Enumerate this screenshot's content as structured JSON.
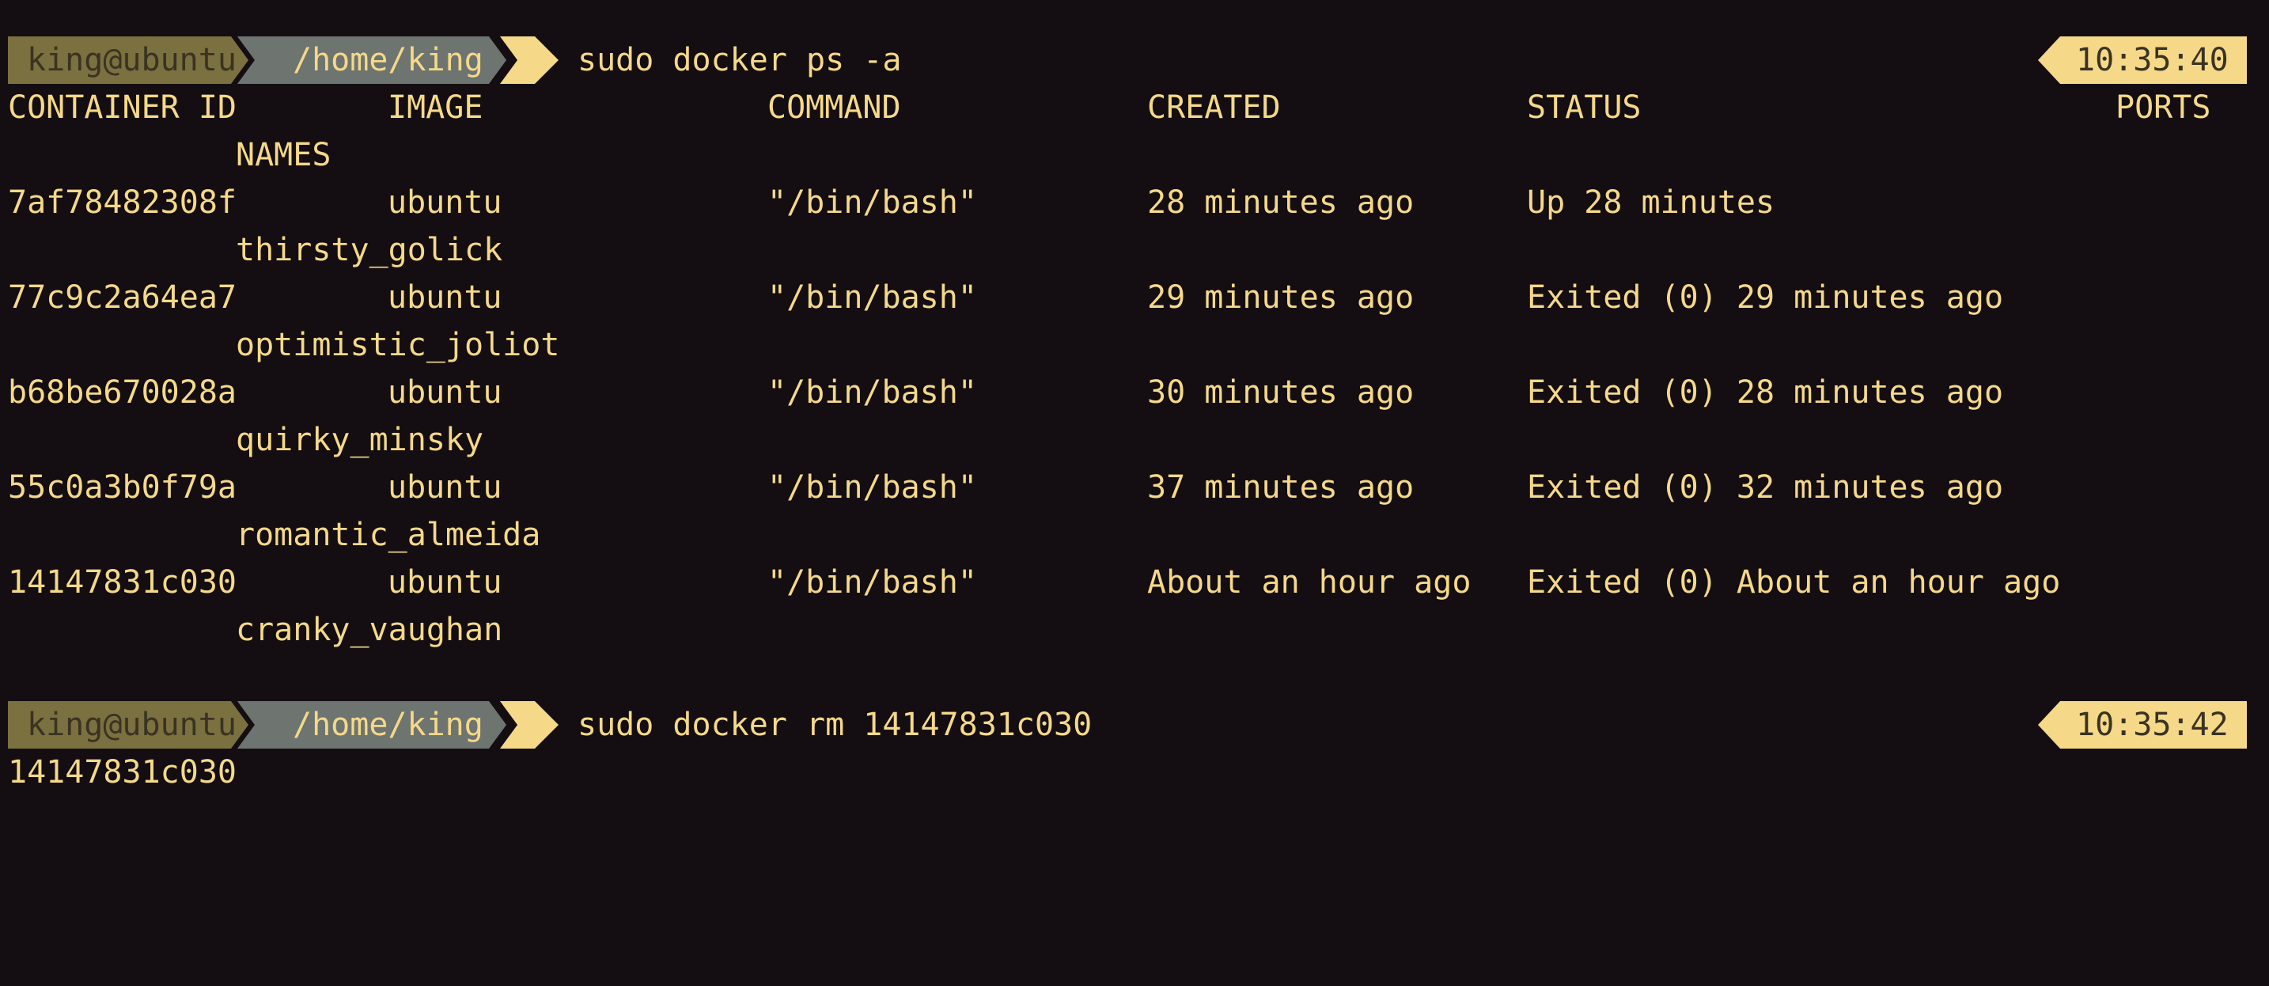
{
  "prompt1": {
    "user": "king@ubuntu",
    "path": "/home/king",
    "command": "sudo docker ps -a",
    "time": "10:35:40"
  },
  "headers": {
    "container_id": "CONTAINER ID",
    "image": "IMAGE",
    "command": "COMMAND",
    "created": "CREATED",
    "status": "STATUS",
    "ports": "PORTS",
    "names": "NAMES"
  },
  "rows": [
    {
      "container_id": "7af78482308f",
      "image": "ubuntu",
      "command": "\"/bin/bash\"",
      "created": "28 minutes ago",
      "status": "Up 28 minutes",
      "names": "thirsty_golick"
    },
    {
      "container_id": "77c9c2a64ea7",
      "image": "ubuntu",
      "command": "\"/bin/bash\"",
      "created": "29 minutes ago",
      "status": "Exited (0) 29 minutes ago",
      "names": "optimistic_joliot"
    },
    {
      "container_id": "b68be670028a",
      "image": "ubuntu",
      "command": "\"/bin/bash\"",
      "created": "30 minutes ago",
      "status": "Exited (0) 28 minutes ago",
      "names": "quirky_minsky"
    },
    {
      "container_id": "55c0a3b0f79a",
      "image": "ubuntu",
      "command": "\"/bin/bash\"",
      "created": "37 minutes ago",
      "status": "Exited (0) 32 minutes ago",
      "names": "romantic_almeida"
    },
    {
      "container_id": "14147831c030",
      "image": "ubuntu",
      "command": "\"/bin/bash\"",
      "created": "About an hour ago",
      "status": "Exited (0) About an hour ago",
      "names": "cranky_vaughan"
    }
  ],
  "prompt2": {
    "user": "king@ubuntu",
    "path": "/home/king",
    "command": "sudo docker rm 14147831c030",
    "time": "10:35:42"
  },
  "output2": "14147831c030",
  "colors": {
    "background": "#140e12",
    "text": "#f5d989",
    "user_segment": "#7b703f",
    "path_segment": "#6e7470",
    "accent": "#f5d989"
  }
}
